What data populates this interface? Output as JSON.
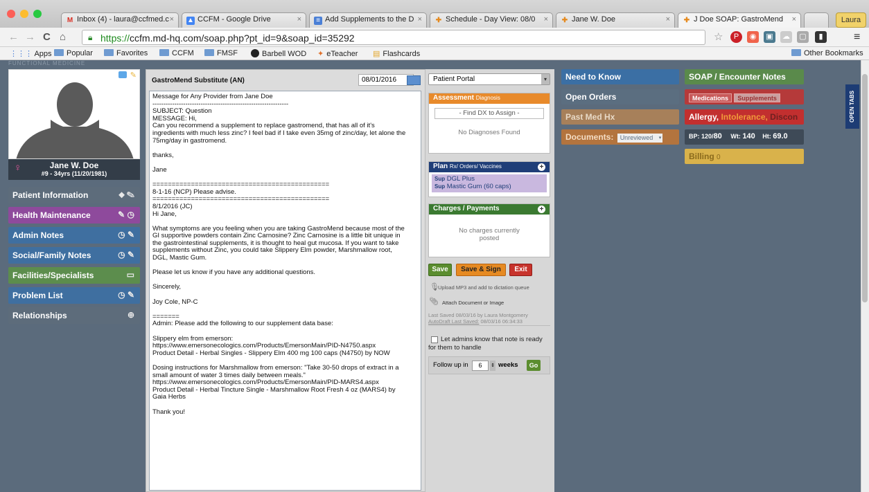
{
  "browser": {
    "tabs": [
      {
        "label": "Inbox (4) - laura@ccfmed.c",
        "icon": "gmail-icon"
      },
      {
        "label": "CCFM - Google Drive",
        "icon": "drive-icon"
      },
      {
        "label": "Add Supplements to the D",
        "icon": "doc-icon"
      },
      {
        "label": "Schedule - Day View: 08/0",
        "icon": "cross-icon"
      },
      {
        "label": "Jane W. Doe",
        "icon": "cross-icon"
      },
      {
        "label": "J Doe SOAP: GastroMend",
        "icon": "cross-icon"
      }
    ],
    "user": "Laura",
    "url_scheme": "https://",
    "url_rest": "ccfm.md-hq.com/soap.php?pt_id=9&soap_id=35292",
    "bookmarks": [
      "Apps",
      "Popular",
      "Favorites",
      "CCFM",
      "FMSF",
      "Barbell WOD",
      "eTeacher",
      "Flashcards"
    ],
    "other_bookmarks": "Other Bookmarks"
  },
  "app": {
    "brand": "FUNCTIONAL MEDICINE",
    "patient": {
      "name": "Jane W. Doe",
      "info": "#9 - 34yrs (11/20/1981)"
    },
    "nav": [
      {
        "label": "Patient Information",
        "color": "#5d6c7b"
      },
      {
        "label": "Health Maintenance",
        "color": "#8e4a9c"
      },
      {
        "label": "Admin Notes",
        "color": "#3f6fa0"
      },
      {
        "label": "Social/Family Notes",
        "color": "#3f6fa0"
      },
      {
        "label": "Facilities/Specialists",
        "color": "#5c8d4d"
      },
      {
        "label": "Problem List",
        "color": "#3f6fa0"
      },
      {
        "label": "Relationships",
        "color": "#5d6c7b"
      }
    ],
    "note": {
      "title": "GastroMend Substitute (AN)",
      "date": "08/01/2016",
      "lines": [
        "Message for Any Provider from Jane Doe",
        "--------------------------------------------------------------",
        "SUBJECT: Question",
        "MESSAGE: Hi,",
        "Can you recommend a supplement to replace gastromend, that has all of it's",
        "ingredients with much less zinc? I feel bad if I take even 35mg of zinc/day, let alone the",
        "75mg/day in gastromend.",
        "",
        "thanks,",
        "",
        "Jane",
        "",
        "==============================================",
        "8-1-16 (NCP) Please advise.",
        "==============================================",
        "8/1/2016 (JC)",
        "Hi Jane,",
        "",
        "What symptoms are you feeling when you are taking GastroMend because most of the",
        "GI supportive powders contain Zinc Carnosine? Zinc Carnosine is a little bit unique in",
        "the gastrointestinal supplements, it is thought to heal gut mucosa. If you want to take",
        "supplements without Zinc, you could take Slippery Elm powder, Marshmallow root,",
        "DGL, Mastic Gum.",
        "",
        "Please let us know if you have any additional questions.",
        "",
        "Sincerely,",
        "",
        "Joy Cole, NP-C",
        "",
        "=======",
        "Admin: Please add the following to our supplement data base:",
        "",
        "Slippery elm from emerson:",
        "https://www.emersonecologics.com/Products/EmersonMain/PID-N4750.aspx",
        "Product Detail - Herbal Singles - Slippery Elm 400 mg 100 caps (N4750) by NOW",
        "",
        "Dosing instructions for Marshmallow from emerson: \"Take 30-50 drops of extract in a",
        "small amount of water 3 times daily between meals.\"",
        "https://www.emersonecologics.com/Products/EmersonMain/PID-MARS4.aspx",
        "Product Detail - Herbal Tincture Single - Marshmallow Root Fresh 4 oz (MARS4) by",
        "Gaia Herbs",
        "",
        "Thank you!"
      ]
    },
    "portal": "Patient Portal",
    "assessment": {
      "title": "Assessment",
      "sub": "Diagnosis",
      "find": "- Find DX to Assign -",
      "empty": "No Diagnoses Found"
    },
    "plan": {
      "title": "Plan",
      "sub": "Rx/ Orders/ Vaccines",
      "items": [
        {
          "tag": "Sup",
          "label": "DGL Plus"
        },
        {
          "tag": "Sup",
          "label": "Mastic Gum (60 caps)"
        }
      ]
    },
    "charges": {
      "title": "Charges / Payments",
      "empty1": "No charges currently",
      "empty2": "posted"
    },
    "actions": {
      "save": "Save",
      "save_sign": "Save & Sign",
      "exit": "Exit"
    },
    "upload": "Upload MP3 and add to dictation queue",
    "attach": "Attach Document or Image",
    "last_saved": "Last Saved 08/03/16 by Laura Montgomery",
    "autodraft": "AutoDraft Last Saved:",
    "autodraft_time": "08/03/16 06:34:33",
    "admin_check": "Let admins know that note is ready for them to handle",
    "followup": {
      "label": "Follow up in",
      "value": "6",
      "unit": "weeks",
      "go": "Go"
    },
    "right": {
      "need_to_know": "Need to Know",
      "open_orders": "Open Orders",
      "past_med": "Past Med Hx",
      "documents": "Documents:",
      "documents_filter": "Unreviewed",
      "soap": "SOAP / Encounter Notes",
      "medications": "Medications",
      "supplements": "Supplements",
      "allergy": "Allergy,",
      "intolerance": "Intolerance,",
      "discon": "Discon",
      "bp_label": "BP:",
      "bp_value": "120",
      "bp_sub": "80",
      "wt_label": "Wt:",
      "wt_value": "140",
      "ht_label": "Ht:",
      "ht_value": "69.0",
      "billing": "Billing",
      "billing_count": "0",
      "open_tabs": "OPEN TABS"
    }
  }
}
